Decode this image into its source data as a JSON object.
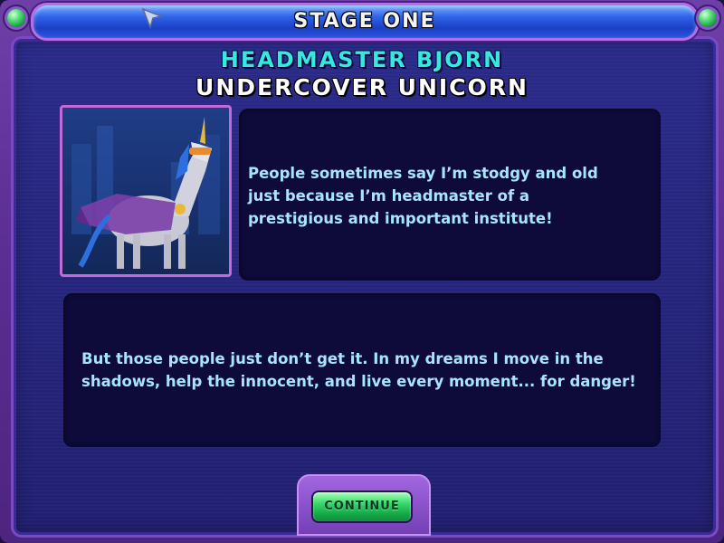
{
  "header": {
    "title": "STAGE ONE"
  },
  "character": {
    "name": "HEADMASTER BJORN",
    "title": "UNDERCOVER UNICORN",
    "portrait_icon": "unicorn-portrait"
  },
  "dialog": {
    "line1": "People sometimes say I’m stodgy and old just because I’m headmaster of a prestigious and important institute!",
    "line2": "But those people just don’t get it. In my dreams I move in the shadows, help the innocent, and live every moment... for danger!"
  },
  "buttons": {
    "continue_label": "CONTINUE"
  },
  "colors": {
    "name_accent": "#35e8e0",
    "dialog_text": "#a9e4ff",
    "button_green": "#34d66a",
    "title_bar_blue": "#2f63e8"
  },
  "icons": [
    "cursor-arrow-icon",
    "gem-icon"
  ]
}
